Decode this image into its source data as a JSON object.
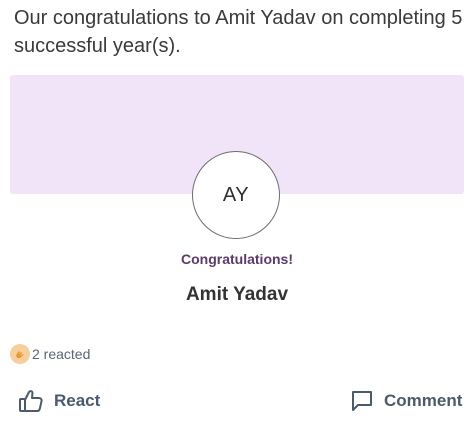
{
  "post": {
    "text": "Our congratulations to Amit Yadav on completing 5 successful year(s)."
  },
  "card": {
    "avatar_initials": "AY",
    "headline": "Congratulations!",
    "honoree_name": "Amit Yadav",
    "banner_color": "#f1e3f8"
  },
  "reactions": {
    "icon": "clap-emoji-icon",
    "summary": "2 reacted"
  },
  "actions": {
    "react_label": "React",
    "react_icon": "thumbs-up-icon",
    "comment_label": "Comment",
    "comment_icon": "speech-bubble-icon"
  }
}
